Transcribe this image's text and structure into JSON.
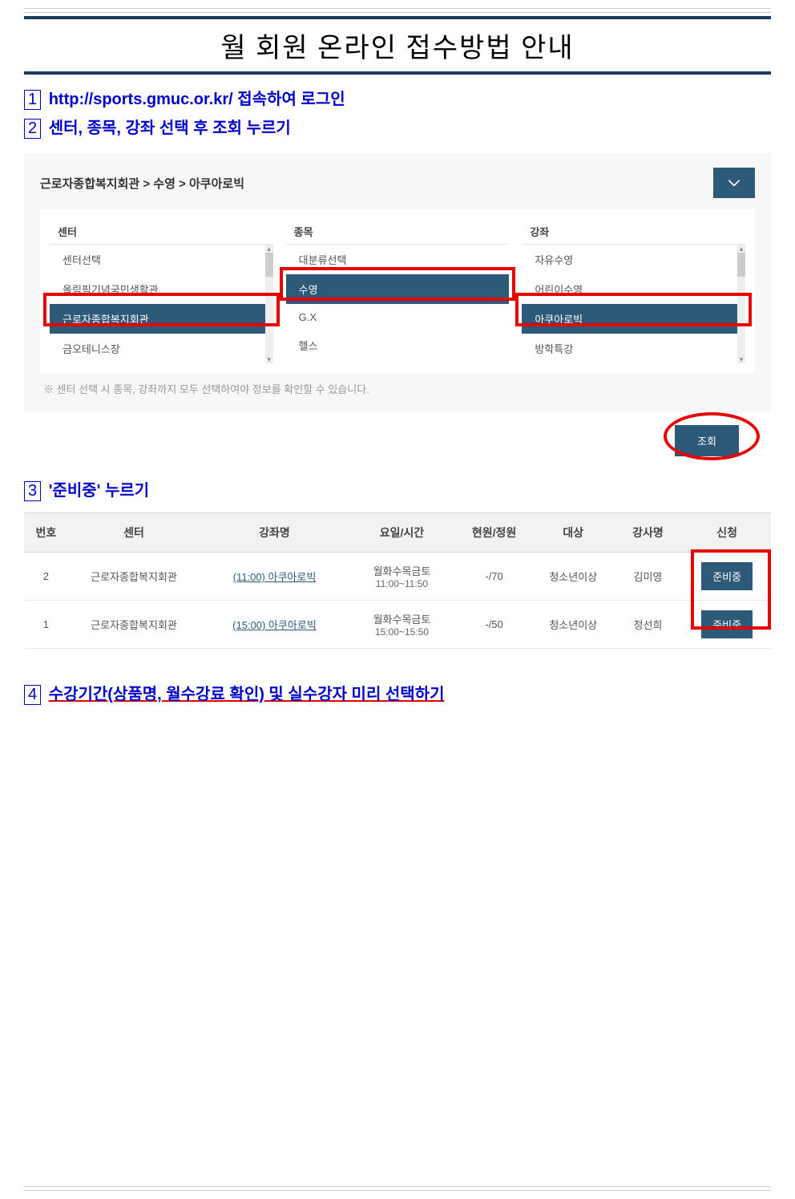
{
  "title": "월 회원 온라인 접수방법 안내",
  "steps": {
    "s1_num": "1",
    "s1_text": "http://sports.gmuc.or.kr/ 접속하여 로그인",
    "s2_num": "2",
    "s2_text": "센터, 종목, 강좌 선택 후 조회 누르기",
    "s3_num": "3",
    "s3_text": "'준비중' 누르기",
    "s4_num": "4",
    "s4_text": "수강기간(상품명, 월수강료 확인) 및 실수강자 미리 선택하기"
  },
  "breadcrumb": "근로자종합복지회관 > 수영 > 아쿠아로빅",
  "cols": {
    "center": {
      "header": "센터",
      "items": [
        "센터선택",
        "올림픽기념국민생활관",
        "근로자종합복지회관",
        "금오테니스장"
      ],
      "selected_index": 2
    },
    "category": {
      "header": "종목",
      "items": [
        "대분류선택",
        "수영",
        "G.X",
        "헬스"
      ],
      "selected_index": 1
    },
    "course": {
      "header": "강좌",
      "items": [
        "자유수영",
        "어린이수영",
        "아쿠아로빅",
        "방학특강"
      ],
      "selected_index": 2
    }
  },
  "help_note": "※ 센터 선택 시 종목, 강좌까지 모두 선택하여야 정보를 확인할 수 있습니다.",
  "search_btn": "조회",
  "table": {
    "headers": [
      "번호",
      "센터",
      "강좌명",
      "요일/시간",
      "현원/정원",
      "대상",
      "강사명",
      "신청"
    ],
    "rows": [
      {
        "no": "2",
        "center": "근로자종합복지회관",
        "course": "(11:00) 아쿠아로빅",
        "day_line1": "월화수목금토",
        "day_line2": "11:00~11:50",
        "capacity": "-/70",
        "target": "청소년이상",
        "instructor": "김미영",
        "status": "준비중"
      },
      {
        "no": "1",
        "center": "근로자종합복지회관",
        "course": "(15:00) 아쿠아로빅",
        "day_line1": "월화수목금토",
        "day_line2": "15:00~15:50",
        "capacity": "-/50",
        "target": "청소년이상",
        "instructor": "정선희",
        "status": "준비중"
      }
    ]
  }
}
